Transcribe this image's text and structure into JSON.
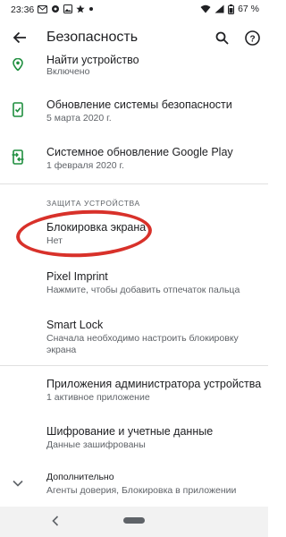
{
  "status_bar": {
    "time": "23:36",
    "battery": "67 %"
  },
  "toolbar": {
    "title": "Безопасность"
  },
  "items_top": [
    {
      "title": "Найти устройство",
      "subtitle": "Включено",
      "icon": "location-pin-icon"
    },
    {
      "title": "Обновление системы безопасности",
      "subtitle": "5 марта 2020 г.",
      "icon": "phone-check-icon"
    },
    {
      "title": "Системное обновление Google Play",
      "subtitle": "1 февраля 2020 г.",
      "icon": "phone-update-icon"
    }
  ],
  "section": {
    "header": "ЗАЩИТА УСТРОЙСТВА"
  },
  "items_protection": [
    {
      "title": "Блокировка экрана",
      "subtitle": "Нет"
    },
    {
      "title": "Pixel Imprint",
      "subtitle": "Нажмите, чтобы добавить отпечаток пальца"
    },
    {
      "title": "Smart Lock",
      "subtitle": "Сначала необходимо настроить блокировку экрана"
    }
  ],
  "items_bottom": [
    {
      "title": "Приложения администратора устройства",
      "subtitle": "1 активное приложение"
    },
    {
      "title": "Шифрование и учетные данные",
      "subtitle": "Данные зашифрованы"
    }
  ],
  "advanced": {
    "title": "Дополнительно",
    "subtitle": "Агенты доверия, Блокировка в приложении"
  },
  "colors": {
    "accent_green": "#1e8e3e",
    "highlight_red": "#d8312a"
  }
}
